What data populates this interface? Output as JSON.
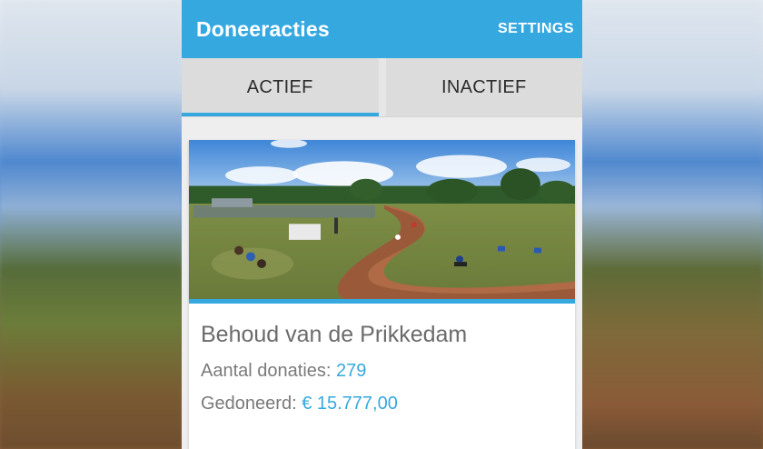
{
  "appbar": {
    "title": "Doneeracties",
    "settings_label": "SETTINGS"
  },
  "tabs": [
    {
      "label": "ACTIEF",
      "active": true
    },
    {
      "label": "INACTIEF",
      "active": false
    }
  ],
  "card": {
    "title": "Behoud van de Prikkedam",
    "donations_label": "Aantal donaties:",
    "donations_value": "279",
    "donated_label": "Gedoneerd:",
    "donated_value": "€ 15.777,00",
    "image": "motocross-track-photo"
  },
  "colors": {
    "accent": "#35a8e0",
    "tab_bg": "#dcdcdc",
    "page_bg": "#eeeeee"
  }
}
